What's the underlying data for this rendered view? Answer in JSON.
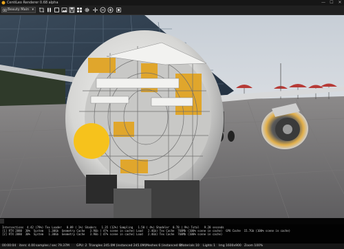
{
  "window": {
    "title": "CentiLeo Renderer 0.68 alpha",
    "controls": [
      "—",
      "☐",
      "✕"
    ]
  },
  "toolbar": {
    "camera_select": "Beauty Main",
    "buttons": [
      {
        "name": "render-region-button",
        "icon": "crop-icon"
      },
      {
        "name": "pause-button",
        "icon": "pause-icon"
      },
      {
        "name": "stop-button",
        "icon": "stop-icon"
      },
      {
        "name": "snapshot-button",
        "icon": "image-icon"
      },
      {
        "name": "save-image-button",
        "icon": "save-icon"
      },
      {
        "name": "settings-button",
        "icon": "gear-icon"
      },
      {
        "name": "zoom-out-button",
        "icon": "minus-circle-icon"
      },
      {
        "name": "zoom-in-button",
        "icon": "plus-circle-icon"
      },
      {
        "name": "fit-view-button",
        "icon": "fit-icon"
      }
    ]
  },
  "stats": {
    "line1": "Intersections  4.42 (79%) Tex Loader   0.09 ( 1%) Shaders   1.35 (12%) Sampling   1.50 ( 4%) Shadeler  0.78 ( 9%) Total   9.28 seconds",
    "line2": "[1] RTX 2080  30%  System   1.30Gb  Geometry Cache   3.9Gb ( 47% scene in cache) Load   2.4Gb) Tex Cache  768Mb (100% scene in cache)  GPU Cache  15.7Gb (100% scene in cache)",
    "line3": "[2] RTX 2080  30%  System   1.30Gb  Geometry Cache   3.9Gb ( 47% scene in cache) Load   2.4Gb) Tex Cache  768Mb (100% scene in cache)"
  },
  "statusbar": {
    "time": "00:00:04",
    "iters": "iters: 4.00",
    "samples": "samples / sec 79.37M",
    "gpu": "GPU: 2",
    "triangles": "Triangles 245.0M (instanced 245.0M)",
    "meshes": "Meshes 6 (instanced 6)",
    "materials": "Materials 10",
    "lights": "Lights 1",
    "img": "Img 1600x900",
    "zoom": "Zoom 100%"
  },
  "colors": {
    "background": "#0b0b0b",
    "toolbar": "#202020",
    "accent_yellow": "#f6c21c",
    "engine_orange": "#e3b04a"
  }
}
